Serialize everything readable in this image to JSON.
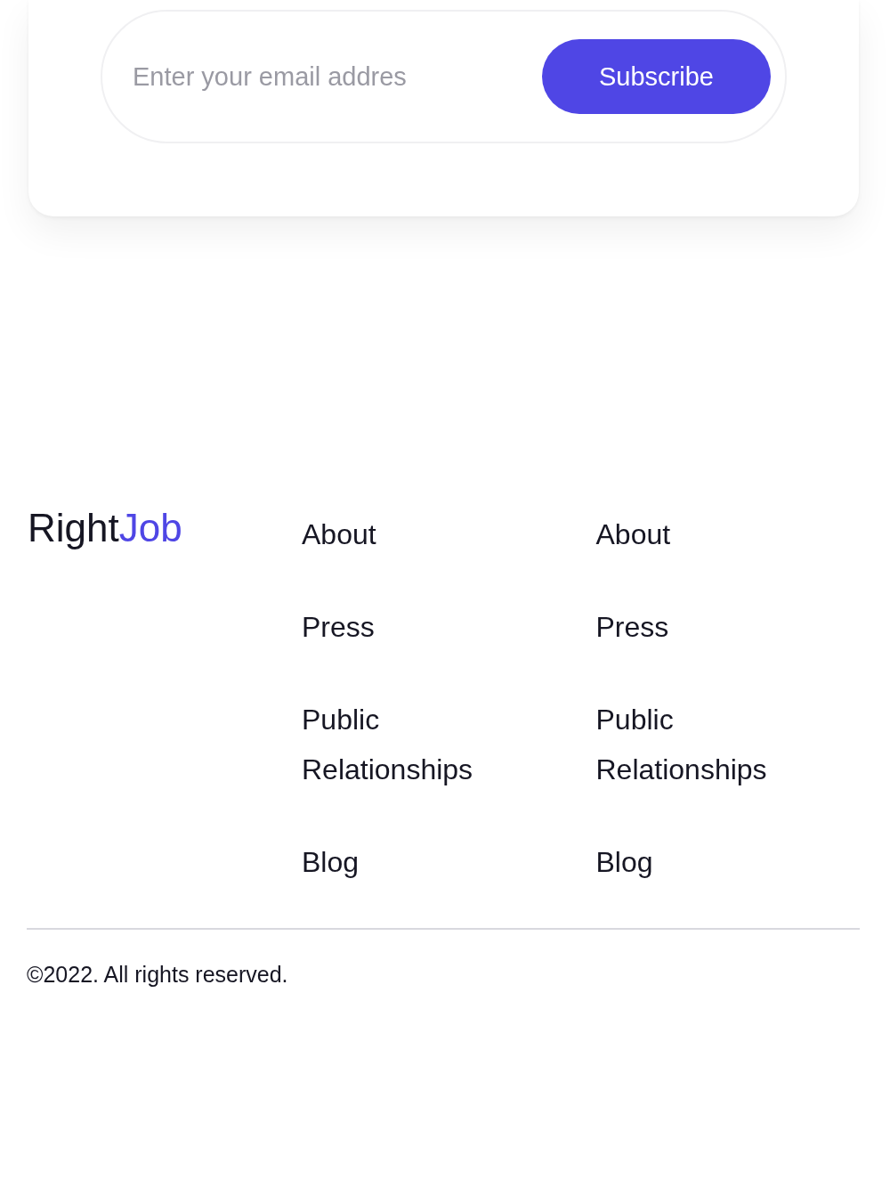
{
  "newsletter": {
    "email_placeholder": "Enter your email addres",
    "button": "Subscribe"
  },
  "footer": {
    "brand": {
      "first": "Right",
      "second": "Job"
    },
    "columns": [
      {
        "links": [
          "About",
          "Press",
          "Public Relationships",
          "Blog"
        ]
      },
      {
        "links": [
          "About",
          "Press",
          "Public Relationships",
          "Blog"
        ]
      }
    ],
    "copyright": "©2022. All rights reserved."
  }
}
